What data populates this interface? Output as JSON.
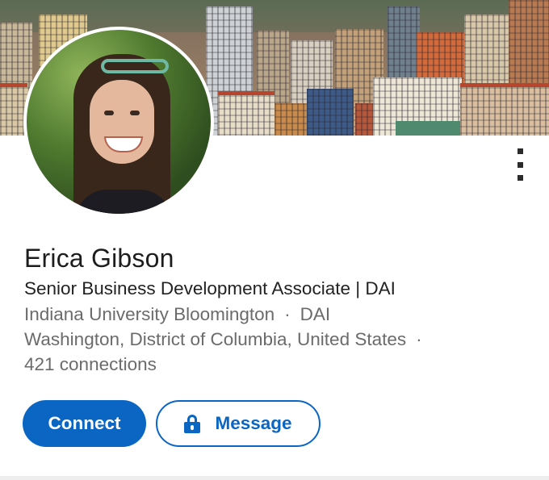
{
  "profile": {
    "name": "Erica Gibson",
    "headline": "Senior Business Development Associate | DAI",
    "education": "Indiana University Bloomington",
    "company": "DAI",
    "location": "Washington, District of Columbia, United States",
    "connections": "421 connections"
  },
  "actions": {
    "connect_label": "Connect",
    "message_label": "Message",
    "message_icon": "lock-icon",
    "more_icon": "more-vertical-icon"
  },
  "colors": {
    "accent": "#0a66c2",
    "primary_text": "#1d1d1d",
    "secondary_text": "#6b6b6b"
  },
  "separator": "·"
}
